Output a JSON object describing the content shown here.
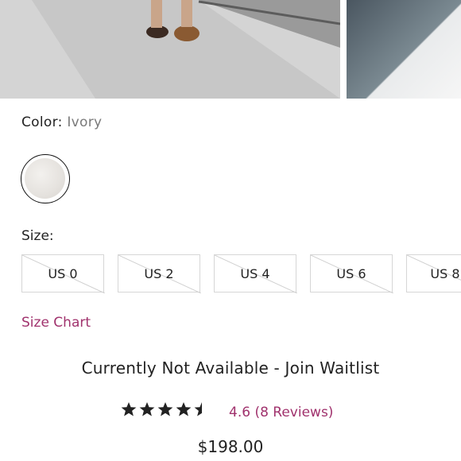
{
  "product": {
    "color_label": "Color:",
    "color_value": "Ivory",
    "swatch_color": "#e8e5e1",
    "size_label": "Size:",
    "sizes": [
      "US 0",
      "US 2",
      "US 4",
      "US 6",
      "US 8"
    ],
    "size_chart_link": "Size Chart",
    "availability": "Currently Not Available - Join Waitlist",
    "rating_stars": 4.5,
    "rating_text": "4.6 (8 Reviews)",
    "price": "$198.00"
  },
  "colors": {
    "accent": "#a0326d",
    "text": "#222222",
    "muted": "#7a7a7a",
    "border": "#d6d6d6"
  }
}
